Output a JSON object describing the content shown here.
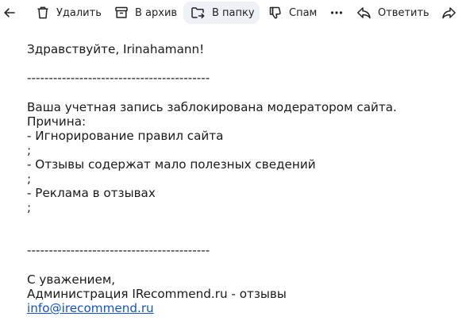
{
  "toolbar": {
    "back_label": "",
    "delete_label": "Удалить",
    "archive_label": "В архив",
    "move_label": "В папку",
    "spam_label": "Спам",
    "more_label": "",
    "reply_label": "Ответить",
    "forward_label": ""
  },
  "icons": {
    "back": "arrow-left-icon",
    "delete": "trash-icon",
    "archive": "archive-box-icon",
    "move": "move-to-folder-icon",
    "spam": "thumbs-down-icon",
    "more": "more-dots-icon",
    "reply": "reply-arrow-icon",
    "forward": "forward-arrow-icon"
  },
  "message": {
    "greeting": "Здравствуйте, Irinahamann!",
    "separator_top": "------------------------------------------",
    "body_line_1": "Ваша учетная запись заблокирована модератором сайта.",
    "body_line_2": "Причина:",
    "reason_1": "- Игнорирование правил сайта",
    "reason_1_end": ";",
    "reason_2": "- Отзывы содержат мало полезных сведений",
    "reason_2_end": ";",
    "reason_3": "- Реклама в отзывах",
    "reason_3_end": ";",
    "separator_bottom": "------------------------------------------",
    "closing": "С уважением,",
    "signature": "Администрация IRecommend.ru - отзывы",
    "email": "info@irecommend.ru"
  },
  "colors": {
    "link": "#1155cc",
    "active_button_bg": "#eef1f5",
    "text": "#1a1a1a"
  }
}
